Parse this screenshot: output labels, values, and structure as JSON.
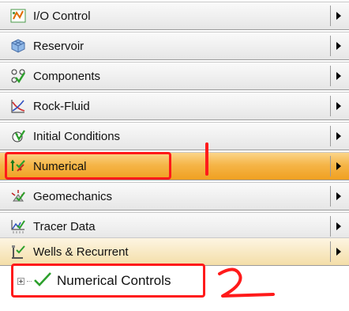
{
  "menu": {
    "items": [
      {
        "label": "I/O Control",
        "icon": "io-control-icon"
      },
      {
        "label": "Reservoir",
        "icon": "reservoir-grid-icon"
      },
      {
        "label": "Components",
        "icon": "components-icon"
      },
      {
        "label": "Rock-Fluid",
        "icon": "rock-fluid-icon"
      },
      {
        "label": "Initial Conditions",
        "icon": "initial-conditions-icon"
      },
      {
        "label": "Numerical",
        "icon": "numerical-icon"
      },
      {
        "label": "Geomechanics",
        "icon": "geomechanics-icon"
      },
      {
        "label": "Tracer Data",
        "icon": "tracer-data-icon"
      },
      {
        "label": "Wells & Recurrent",
        "icon": "wells-recurrent-icon"
      }
    ],
    "active": "Numerical"
  },
  "tree": {
    "item_label": "Numerical Controls",
    "status_icon": "checkmark-icon"
  },
  "annotations": {
    "mark_1": "1",
    "mark_2": "2",
    "color": "#ff1a1a"
  },
  "colors": {
    "active_row": "#f5b548",
    "check_green": "#2ca02c"
  }
}
